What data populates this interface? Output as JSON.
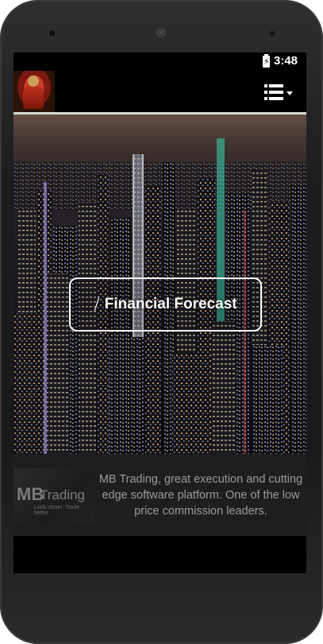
{
  "status_bar": {
    "time": "3:48"
  },
  "action_bar": {
    "logo_icon": "app-logo-icon",
    "menu_icon": "list-menu-icon"
  },
  "hero": {
    "button_label": "Financial Forecast",
    "button_icon": "magic-wand-icon"
  },
  "ad": {
    "logo_mb": "MB",
    "logo_trading": "Trading",
    "logo_tagline": "Look closer. Trade better.",
    "text": "MB Trading, great execution and cutting edge software platform. One of the low price commission leaders."
  },
  "colors": {
    "screen_bg": "#000000",
    "ad_bg": "#1e1e1e",
    "ad_text": "#9b9b9b",
    "divider": "#d9d9d9"
  }
}
